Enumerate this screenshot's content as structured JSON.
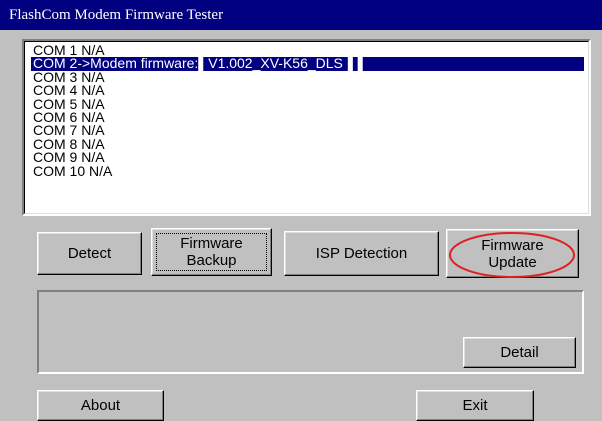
{
  "window": {
    "title": "FlashCom Modem Firmware Tester"
  },
  "com_list": {
    "items": [
      {
        "label": "COM 1 N/A",
        "selected": false
      },
      {
        "label": "COM 2->Modem firmware:▌V1.002_XV-K56_DLS▐▐",
        "selected": true
      },
      {
        "label": "COM 3 N/A",
        "selected": false
      },
      {
        "label": "COM 4 N/A",
        "selected": false
      },
      {
        "label": "COM 5 N/A",
        "selected": false
      },
      {
        "label": "COM 6 N/A",
        "selected": false
      },
      {
        "label": "COM 7 N/A",
        "selected": false
      },
      {
        "label": "COM 8 N/A",
        "selected": false
      },
      {
        "label": "COM 9 N/A",
        "selected": false
      },
      {
        "label": "COM 10 N/A",
        "selected": false
      }
    ]
  },
  "buttons": {
    "detect": "Detect",
    "firmware_backup": "Firmware\nBackup",
    "isp_detection": "ISP Detection",
    "firmware_update": "Firmware\nUpdate",
    "detail": "Detail",
    "about": "About",
    "exit": "Exit"
  },
  "colors": {
    "face": "#c0c0c0",
    "title_bar": "#000080",
    "selection": "#000080",
    "annotation_circle": "#e02020"
  }
}
